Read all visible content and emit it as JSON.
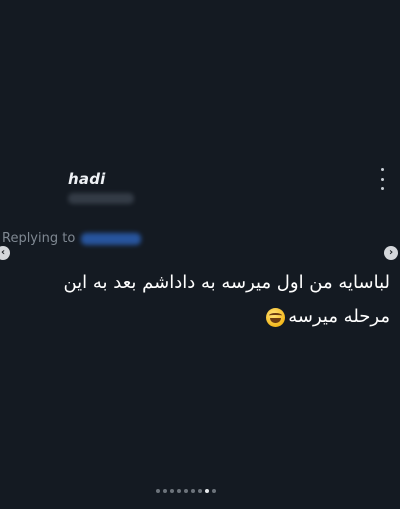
{
  "post": {
    "author_name": "hadi",
    "replying_prefix": "Replying to",
    "text_line1": "لباسایه من اول میرسه به داداشم بعد به این",
    "text_line2": "مرحله میرسه",
    "emoji": "😂"
  },
  "icons": {
    "more": "more-vertical-icon",
    "prev": "chevron-left-icon",
    "next": "chevron-right-icon",
    "emoji": "grinning-sweat-emoji-icon"
  },
  "pagination": {
    "total": 9,
    "active_index": 7
  },
  "colors": {
    "background": "#141a22",
    "text": "#ffffff",
    "muted": "#7f8892",
    "link": "#2b5fb3"
  }
}
